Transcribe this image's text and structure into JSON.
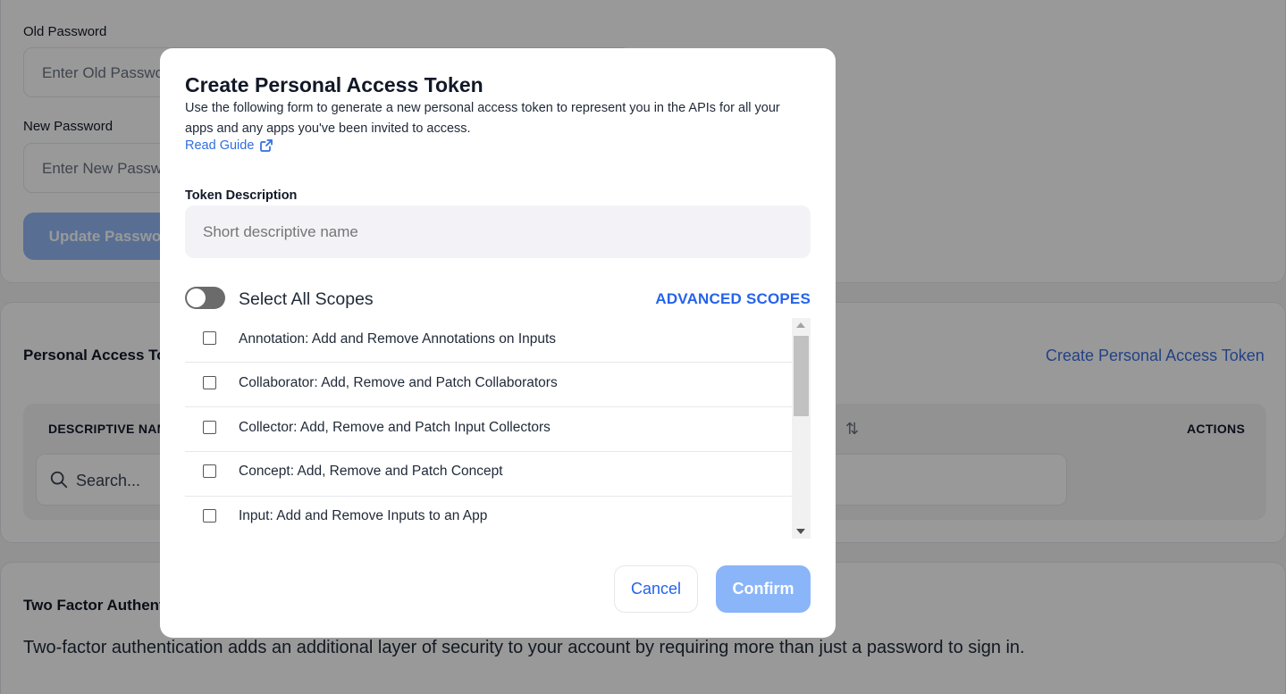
{
  "background": {
    "password": {
      "old_label": "Old Password",
      "old_placeholder": "Enter Old Password",
      "new_label": "New Password",
      "new_placeholder": "Enter New Password",
      "update_button": "Update Password"
    },
    "pat": {
      "title": "Personal Access Tokens",
      "create_link": "Create Personal Access Token",
      "columns": [
        "DESCRIPTIVE NAME",
        "ACTIONS"
      ],
      "search_placeholder": "Search..."
    },
    "two_factor": {
      "title": "Two Factor Authentication",
      "description": "Two-factor authentication adds an additional layer of security to your account by requiring more than just a password to sign in."
    }
  },
  "modal": {
    "title": "Create Personal Access Token",
    "description": "Use the following form to generate a new personal access token to represent you in the APIs for all your apps and any apps you've been invited to access.",
    "guide_link": "Read Guide",
    "token_label": "Token Description",
    "token_placeholder": "Short descriptive name",
    "select_all": "Select All Scopes",
    "select_all_checked": false,
    "advanced": "ADVANCED SCOPES",
    "scopes": [
      {
        "label": "Annotation: Add and Remove Annotations on Inputs",
        "checked": false
      },
      {
        "label": "Collaborator: Add, Remove and Patch Collaborators",
        "checked": false
      },
      {
        "label": "Collector: Add, Remove and Patch Input Collectors",
        "checked": false
      },
      {
        "label": "Concept: Add, Remove and Patch Concept",
        "checked": false
      },
      {
        "label": "Input: Add and Remove Inputs to an App",
        "checked": false
      }
    ],
    "cancel": "Cancel",
    "confirm": "Confirm"
  },
  "colors": {
    "accent": "#2563eb",
    "confirm_disabled": "#8ab5f8",
    "overlay": "rgba(0,0,0,0.4)"
  }
}
